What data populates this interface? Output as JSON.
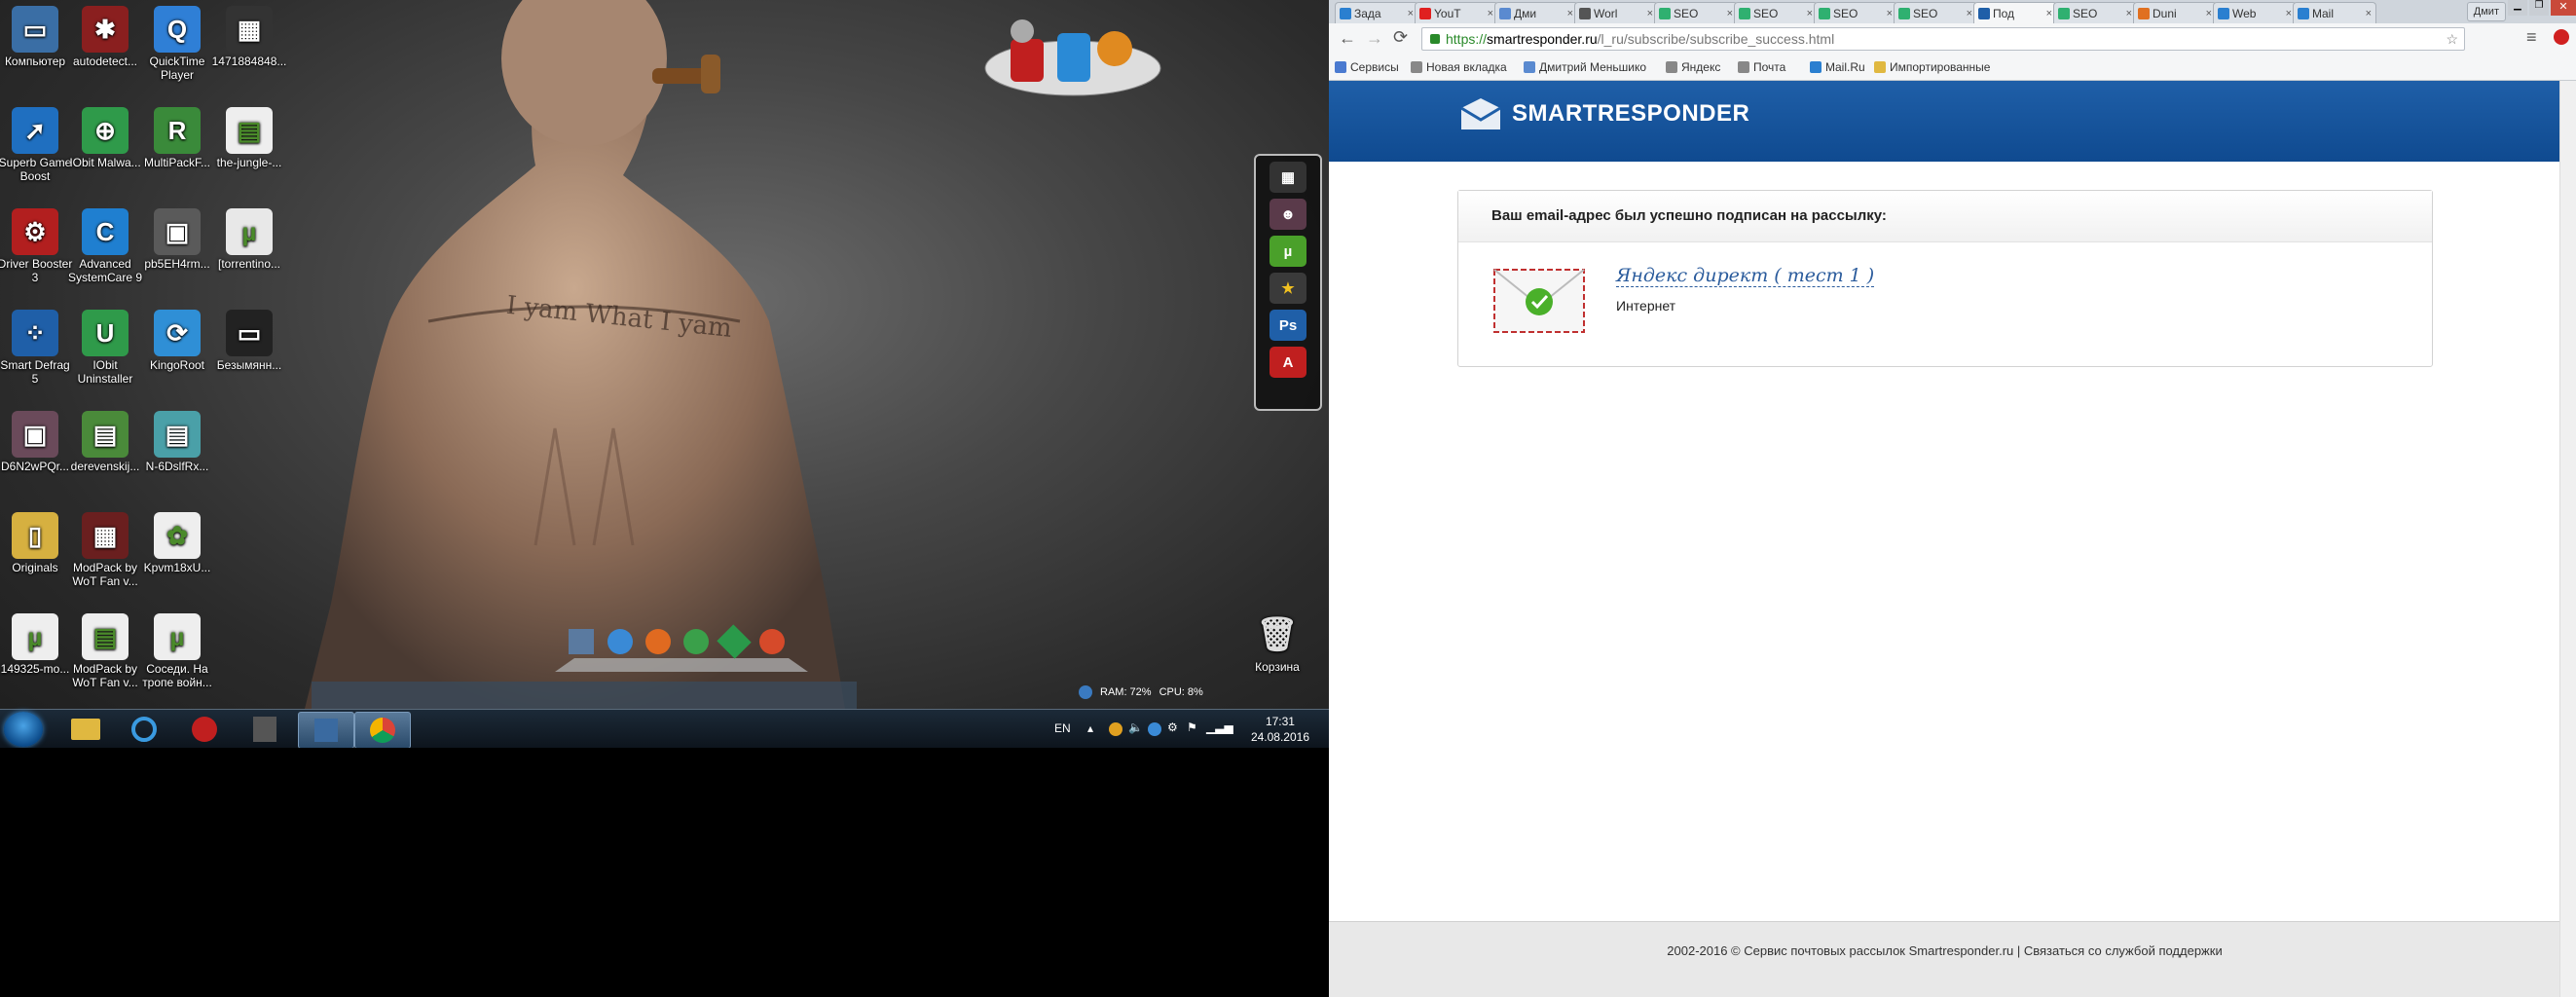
{
  "desktop": {
    "icons": [
      {
        "label": "Компьютер",
        "color": "#3a6ea5",
        "glyph": "▭"
      },
      {
        "label": "autodetect...",
        "color": "#8a1f1f",
        "glyph": "✱"
      },
      {
        "label": "QuickTime Player",
        "color": "#2f7fd6",
        "glyph": "Q"
      },
      {
        "label": "1471884848...",
        "color": "#333",
        "glyph": "▦"
      },
      {
        "label": "Superb Game Boost",
        "color": "#1f6fc0",
        "glyph": "➚"
      },
      {
        "label": "IObit Malwa...",
        "color": "#2f9a4a",
        "glyph": "⊕"
      },
      {
        "label": "MultiPackF...",
        "color": "#3a8a3a",
        "glyph": "R"
      },
      {
        "label": "the-jungle-...",
        "color": "#eeeeee",
        "glyph": "▤"
      },
      {
        "label": "Driver Booster 3",
        "color": "#b21f1f",
        "glyph": "⚙"
      },
      {
        "label": "Advanced SystemCare 9",
        "color": "#1f7fd0",
        "glyph": "C"
      },
      {
        "label": "pb5EH4rm...",
        "color": "#5a5a5a",
        "glyph": "▣"
      },
      {
        "label": "[torrentino...",
        "color": "#e8e8e8",
        "glyph": "µ"
      },
      {
        "label": "Smart Defrag 5",
        "color": "#1f5fa8",
        "glyph": "⁘"
      },
      {
        "label": "IObit Uninstaller",
        "color": "#2f9a4a",
        "glyph": "U"
      },
      {
        "label": "KingoRoot",
        "color": "#2f8fd6",
        "glyph": "⟳"
      },
      {
        "label": "Безымянн...",
        "color": "#222",
        "glyph": "▭"
      },
      {
        "label": "D6N2wPQr...",
        "color": "#6a4a5a",
        "glyph": "▣"
      },
      {
        "label": "derevenskij...",
        "color": "#4a8a3a",
        "glyph": "▤"
      },
      {
        "label": "N-6DslfRx...",
        "color": "#4aa0a8",
        "glyph": "▤"
      },
      {
        "label": "Originals",
        "color": "#d6b040",
        "glyph": "▯"
      },
      {
        "label": "ModPack by WoT Fan v...",
        "color": "#6a1f1f",
        "glyph": "▦"
      },
      {
        "label": "Kpvm18xU...",
        "color": "#eeeeee",
        "glyph": "✿"
      },
      {
        "label": "149325-mo...",
        "color": "#eeeeee",
        "glyph": "µ"
      },
      {
        "label": "ModPack by WoT Fan v...",
        "color": "#eeeeee",
        "glyph": "▤"
      },
      {
        "label": "Соседи. На тропе войн...",
        "color": "#eeeeee",
        "glyph": "µ"
      }
    ],
    "recycle_label": "Корзина",
    "sys_monitor": {
      "ram": "RAM: 72%",
      "cpu": "CPU: 8%"
    },
    "taskbar": {
      "lang": "EN",
      "time": "17:31",
      "date": "24.08.2016"
    }
  },
  "browser": {
    "tabs": [
      {
        "title": "Зада",
        "color": "#2a7fd0"
      },
      {
        "title": "YouT",
        "color": "#e02020"
      },
      {
        "title": "Дми",
        "color": "#5a8ad0"
      },
      {
        "title": "Worl",
        "color": "#555"
      },
      {
        "title": "SEO",
        "color": "#2fb070"
      },
      {
        "title": "SEO",
        "color": "#2fb070"
      },
      {
        "title": "SEO",
        "color": "#2fb070"
      },
      {
        "title": "SEO",
        "color": "#2fb070"
      },
      {
        "title": "Под",
        "color": "#1f5fa8",
        "active": true
      },
      {
        "title": "SEO",
        "color": "#2fb070"
      },
      {
        "title": "Duni",
        "color": "#e07020"
      },
      {
        "title": "Web",
        "color": "#2a7fd0"
      },
      {
        "title": "Mail",
        "color": "#2a7fd0"
      }
    ],
    "user_label": "Дмит",
    "url_scheme": "https://",
    "url_host": "smartresponder.ru",
    "url_path": "/l_ru/subscribe/subscribe_success.html",
    "bookmarks": [
      "Сервисы",
      "Новая вкладка",
      "Дмитрий Меньшико",
      "Яндекс",
      "Почта",
      "Mail.Ru",
      "Импортированные"
    ],
    "page": {
      "logo": "SMARTRESPONDER",
      "panel_heading": "Ваш email-адрес был успешно подписан на рассылку:",
      "list_title": "Яндекс директ ( тест 1 )",
      "list_category": "Интернет",
      "footer": "2002-2016 © Сервис почтовых рассылок Smartresponder.ru | Связаться со службой поддержки"
    }
  }
}
